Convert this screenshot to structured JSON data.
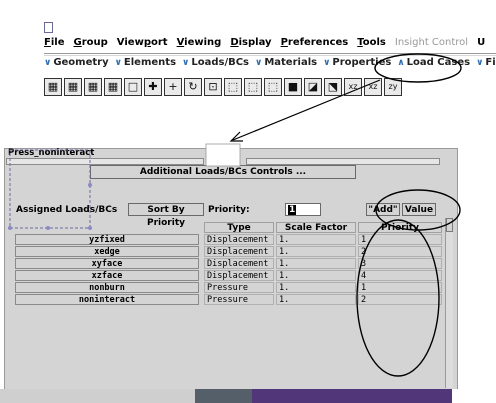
{
  "menubar": {
    "items": [
      {
        "label": "File",
        "key": "F"
      },
      {
        "label": "Group",
        "key": "G"
      },
      {
        "label": "Viewport",
        "key": "p"
      },
      {
        "label": "Viewing",
        "key": "V"
      },
      {
        "label": "Display",
        "key": "D"
      },
      {
        "label": "Preferences",
        "key": "P"
      },
      {
        "label": "Tools",
        "key": "T"
      }
    ],
    "disabled_item": "Insight Control",
    "trailing_letter": "U"
  },
  "group_bar": {
    "items": [
      "Geometry",
      "Elements",
      "Loads/BCs",
      "Materials",
      "Properties",
      "Load Cases",
      "Fiel"
    ]
  },
  "icon_toolbar": {
    "icons": [
      "grid-icon",
      "grid-icon",
      "grid-icon",
      "grid-icon",
      "square-icon",
      "plus-move-icon",
      "plus-icon",
      "rotate-icon",
      "zoom-box-icon",
      "cube-icon",
      "cube-icon",
      "cube-icon",
      "cube-solid-icon",
      "shade-icon",
      "view-axes-icon",
      "xz-view-icon",
      "zx-view-icon",
      "zy-view-icon"
    ],
    "glyphs": [
      "▦",
      "▦",
      "▦",
      "▦",
      "□",
      "✚",
      "+",
      "↻",
      "⊡",
      "⬚",
      "⬚",
      "⬚",
      "■",
      "◪",
      "⬔",
      "xz",
      "xz",
      "zy"
    ]
  },
  "panel": {
    "title_field": "Press_noninteract",
    "additional_btn": "Additional Loads/BCs Controls ...",
    "assigned_label": "Assigned Loads/BCs",
    "sort_btn": "Sort By Priority",
    "priority_label": "Priority:",
    "priority_value": "1",
    "add_btn": "\"Add\"",
    "value_btn": "Value",
    "columns": {
      "type": "Type",
      "scale": "Scale Factor",
      "priority": "Priority"
    },
    "rows": [
      {
        "name": "yzfixed",
        "type": "Displacement",
        "scale": "1.",
        "priority": "1"
      },
      {
        "name": "xedge",
        "type": "Displacement",
        "scale": "1.",
        "priority": "2"
      },
      {
        "name": "xyface",
        "type": "Displacement",
        "scale": "1.",
        "priority": "3"
      },
      {
        "name": "xzface",
        "type": "Displacement",
        "scale": "1.",
        "priority": "4"
      },
      {
        "name": "nonburn",
        "type": "Pressure",
        "scale": "1.",
        "priority": "1"
      },
      {
        "name": "noninteract",
        "type": "Pressure",
        "scale": "1.",
        "priority": "2"
      }
    ]
  },
  "colors": {
    "panel_bg": "#d4d4d4",
    "annotation": "#000000",
    "chevron": "#2a6ab0",
    "selection_dots": "#8a8ac0"
  }
}
